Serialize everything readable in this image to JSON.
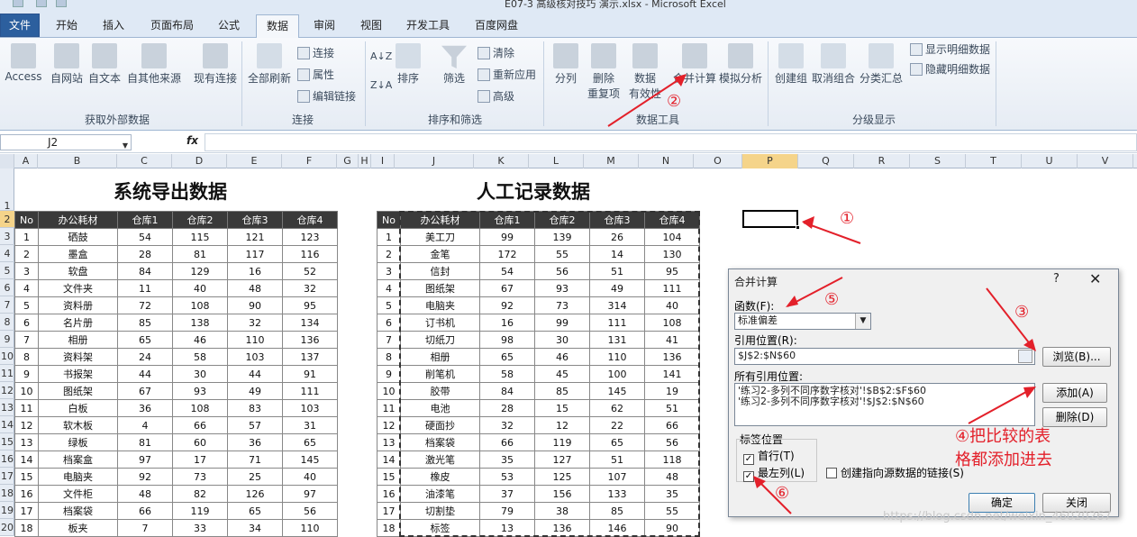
{
  "window": {
    "title": "E07-3 高级核对技巧 演示.xlsx - Microsoft Excel"
  },
  "tabs": [
    "文件",
    "开始",
    "插入",
    "页面布局",
    "公式",
    "数据",
    "审阅",
    "视图",
    "开发工具",
    "百度网盘"
  ],
  "ribbon": {
    "get_external": {
      "access": "Access",
      "web": "自网站",
      "text": "自文本",
      "other": "自其他来源",
      "existing": "现有连接",
      "group": "获取外部数据"
    },
    "connections": {
      "refresh_all": "全部刷新",
      "connections": "连接",
      "properties": "属性",
      "edit_links": "编辑链接",
      "group": "连接"
    },
    "sort_filter": {
      "sort_az": "A↓Z",
      "sort_za": "Z↓A",
      "sort": "排序",
      "filter": "筛选",
      "clear": "清除",
      "reapply": "重新应用",
      "advanced": "高级",
      "group": "排序和筛选"
    },
    "data_tools": {
      "split": "分列",
      "remove_dup_1": "删除",
      "remove_dup_2": "重复项",
      "validation_1": "数据",
      "validation_2": "有效性",
      "consolidate": "合并计算",
      "whatif": "模拟分析",
      "group": "数据工具"
    },
    "outline": {
      "group_btn": "创建组",
      "ungroup": "取消组合",
      "subtotal": "分类汇总",
      "show_detail": "显示明细数据",
      "hide_detail": "隐藏明细数据",
      "group": "分级显示"
    }
  },
  "formula_bar": {
    "name_box": "J2",
    "fx": "fx",
    "formula": ""
  },
  "columns": [
    "A",
    "B",
    "C",
    "D",
    "E",
    "F",
    "G",
    "H",
    "I",
    "J",
    "K",
    "L",
    "M",
    "N",
    "O",
    "P",
    "Q",
    "R",
    "S",
    "T",
    "U",
    "V"
  ],
  "rows": [
    "1",
    "2",
    "3",
    "4",
    "5",
    "6",
    "7",
    "8",
    "9",
    "10",
    "11",
    "12",
    "13",
    "14",
    "15",
    "16",
    "17",
    "18",
    "19",
    "20"
  ],
  "sheet": {
    "title_left": "系统导出数据",
    "title_right": "人工记录数据",
    "headers": [
      "No",
      "办公耗材",
      "仓库1",
      "仓库2",
      "仓库3",
      "仓库4"
    ],
    "left_rows": [
      [
        "1",
        "硒鼓",
        "54",
        "115",
        "121",
        "123"
      ],
      [
        "2",
        "墨盒",
        "28",
        "81",
        "117",
        "116"
      ],
      [
        "3",
        "软盘",
        "84",
        "129",
        "16",
        "52"
      ],
      [
        "4",
        "文件夹",
        "11",
        "40",
        "48",
        "32"
      ],
      [
        "5",
        "资料册",
        "72",
        "108",
        "90",
        "95"
      ],
      [
        "6",
        "名片册",
        "85",
        "138",
        "32",
        "134"
      ],
      [
        "7",
        "相册",
        "65",
        "46",
        "110",
        "136"
      ],
      [
        "8",
        "资料架",
        "24",
        "58",
        "103",
        "137"
      ],
      [
        "9",
        "书报架",
        "44",
        "30",
        "44",
        "91"
      ],
      [
        "10",
        "图纸架",
        "67",
        "93",
        "49",
        "111"
      ],
      [
        "11",
        "白板",
        "36",
        "108",
        "83",
        "103"
      ],
      [
        "12",
        "软木板",
        "4",
        "66",
        "57",
        "31"
      ],
      [
        "13",
        "绿板",
        "81",
        "60",
        "36",
        "65"
      ],
      [
        "14",
        "档案盒",
        "97",
        "17",
        "71",
        "145"
      ],
      [
        "15",
        "电脑夹",
        "92",
        "73",
        "25",
        "40"
      ],
      [
        "16",
        "文件柜",
        "48",
        "82",
        "126",
        "97"
      ],
      [
        "17",
        "档案袋",
        "66",
        "119",
        "65",
        "56"
      ],
      [
        "18",
        "板夹",
        "7",
        "33",
        "34",
        "110"
      ]
    ],
    "right_rows": [
      [
        "1",
        "美工刀",
        "99",
        "139",
        "26",
        "104"
      ],
      [
        "2",
        "金笔",
        "172",
        "55",
        "14",
        "130"
      ],
      [
        "3",
        "信封",
        "54",
        "56",
        "51",
        "95"
      ],
      [
        "4",
        "图纸架",
        "67",
        "93",
        "49",
        "111"
      ],
      [
        "5",
        "电脑夹",
        "92",
        "73",
        "314",
        "40"
      ],
      [
        "6",
        "订书机",
        "16",
        "99",
        "111",
        "108"
      ],
      [
        "7",
        "切纸刀",
        "98",
        "30",
        "131",
        "41"
      ],
      [
        "8",
        "相册",
        "65",
        "46",
        "110",
        "136"
      ],
      [
        "9",
        "削笔机",
        "58",
        "45",
        "100",
        "141"
      ],
      [
        "10",
        "胶带",
        "84",
        "85",
        "145",
        "19"
      ],
      [
        "11",
        "电池",
        "28",
        "15",
        "62",
        "51"
      ],
      [
        "12",
        "硬面抄",
        "32",
        "12",
        "22",
        "66"
      ],
      [
        "13",
        "档案袋",
        "66",
        "119",
        "65",
        "56"
      ],
      [
        "14",
        "激光笔",
        "35",
        "127",
        "51",
        "118"
      ],
      [
        "15",
        "橡皮",
        "53",
        "125",
        "107",
        "48"
      ],
      [
        "16",
        "油漆笔",
        "37",
        "156",
        "133",
        "35"
      ],
      [
        "17",
        "切割垫",
        "79",
        "38",
        "85",
        "55"
      ],
      [
        "18",
        "标签",
        "13",
        "136",
        "146",
        "90"
      ]
    ]
  },
  "dialog": {
    "title": "合并计算",
    "help": "?",
    "close": "✕",
    "function_label": "函数(F):",
    "function_value": "标准偏差",
    "ref_label": "引用位置(R):",
    "ref_value": "$J$2:$N$60",
    "browse": "浏览(B)...",
    "all_refs_label": "所有引用位置:",
    "all_refs": [
      "'练习2-多列不同序数字核对'!$B$2:$F$60",
      "'练习2-多列不同序数字核对'!$J$2:$N$60"
    ],
    "add": "添加(A)",
    "delete": "删除(D)",
    "label_pos": "标签位置",
    "top_row": "首行(T)",
    "left_col": "最左列(L)",
    "create_links": "创建指向源数据的链接(S)",
    "ok": "确定",
    "close_btn": "关闭"
  },
  "annotations": {
    "n1": "①",
    "n2": "②",
    "n3": "③",
    "n5": "⑤",
    "n6": "⑥",
    "note_1": "④把比较的表",
    "note_2": "格都添加进去"
  },
  "watermark": "https://blog.csdn.net/weixin_46020267",
  "colors": {
    "accent": "#2c5f9e",
    "annotation": "#e3202a",
    "header_bg": "#3a3a3a",
    "selected_header": "#f5d48a"
  }
}
